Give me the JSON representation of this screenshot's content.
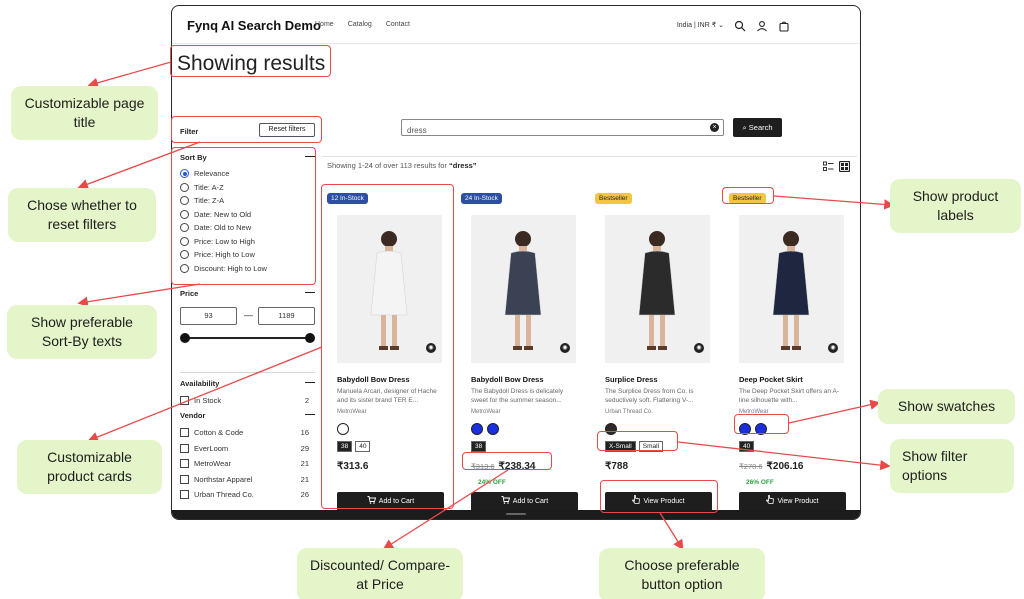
{
  "app": {
    "brand": "Fynq AI Search Demo",
    "nav": [
      "Home",
      "Catalog",
      "Contact"
    ],
    "locale": "India | INR ₹ ⌄"
  },
  "page_title": "Showing results",
  "filter": {
    "label": "Filter",
    "reset_label": "Reset filters",
    "sort_by": {
      "title": "Sort By",
      "selected": "Relevance",
      "options": [
        "Relevance",
        "Title: A-Z",
        "Title: Z-A",
        "Date: New to Old",
        "Date: Old to New",
        "Price: Low to High",
        "Price: High to Low",
        "Discount: High to Low"
      ]
    },
    "price": {
      "title": "Price",
      "min": "93",
      "max": "1189",
      "dash": "—"
    },
    "availability": {
      "title": "Availability",
      "items": [
        {
          "label": "In Stock",
          "count": "2"
        }
      ]
    },
    "vendor": {
      "title": "Vendor",
      "items": [
        {
          "label": "Cotton & Code",
          "count": "16"
        },
        {
          "label": "EverLoom",
          "count": "29"
        },
        {
          "label": "MetroWear",
          "count": "21"
        },
        {
          "label": "Northstar Apparel",
          "count": "21"
        },
        {
          "label": "Urban Thread Co.",
          "count": "26"
        }
      ]
    }
  },
  "search": {
    "value": "dress",
    "button_label": "Search"
  },
  "results": {
    "prefix": "Showing 1-24 of over 113 results for",
    "query": "“dress”"
  },
  "products": [
    {
      "badge": "12 In-Stock",
      "badge_style": "blue",
      "name": "Babydoll Bow Dress",
      "desc": "Manuela Arcari, designer of Hache and its sister brand TER E...",
      "vendor": "MetroWear",
      "swatches": [
        "#ffffff"
      ],
      "sizes": [
        "38",
        "40"
      ],
      "price": "₹313.6",
      "compare_at": "",
      "discount": "",
      "cta": "Add to Cart",
      "cta_icon": "cart-icon",
      "dress_color": "#f4f4f4"
    },
    {
      "badge": "24 In-Stock",
      "badge_style": "blue",
      "name": "Babydoll Bow Dress",
      "desc": "The Babydoll Dress is delicately sweet for the summer season...",
      "vendor": "MetroWear",
      "swatches": [
        "#1a2fe0",
        "#1a2fe0"
      ],
      "sizes": [
        "38"
      ],
      "price": "₹238.34",
      "compare_at": "₹313.6",
      "discount": "24% OFF",
      "cta": "Add to Cart",
      "cta_icon": "cart-icon",
      "dress_color": "#3b4253"
    },
    {
      "badge": "Bestseller",
      "badge_style": "yellow",
      "name": "Surplice Dress",
      "desc": "The Surplice Dress from Co. is seductively soft. Flattering V-...",
      "vendor": "Urban Thread Co.",
      "swatches": [
        "#2b2b2b"
      ],
      "sizes": [
        "X-Small",
        "Small"
      ],
      "price": "₹788",
      "compare_at": "",
      "discount": "",
      "cta": "View Product",
      "cta_icon": "pointer-icon",
      "dress_color": "#2b2b2b"
    },
    {
      "badge": "Bestseller",
      "badge_style": "yellow",
      "name": "Deep Pocket Skirt",
      "desc": "The Deep Pocket Skirt offers an A-line silhouette with...",
      "vendor": "MetroWear",
      "swatches": [
        "#1a2fe0",
        "#1a2fe0"
      ],
      "sizes": [
        "40"
      ],
      "price": "₹206.16",
      "compare_at": "₹278.6",
      "discount": "26% OFF",
      "cta": "View Product",
      "cta_icon": "pointer-icon",
      "dress_color": "#1f2740"
    }
  ],
  "annotations": {
    "page_title": "Customizable page title",
    "reset": "Chose whether to reset filters",
    "sortby": "Show preferable Sort-By texts",
    "cards": "Customizable product cards",
    "price": "Discounted/ Compare-at Price",
    "button": "Choose preferable button option",
    "labels": "Show product labels",
    "swatches": "Show swatches",
    "filter_options": "Show filter options"
  },
  "colors": {
    "annotation_red": "#e84a4a",
    "callout_green": "#e4f5c9",
    "accent_blue": "#1f5bd8",
    "badge_blue": "#2c4ea3",
    "badge_yellow": "#f4c542",
    "discount_green": "#2f9e44"
  }
}
